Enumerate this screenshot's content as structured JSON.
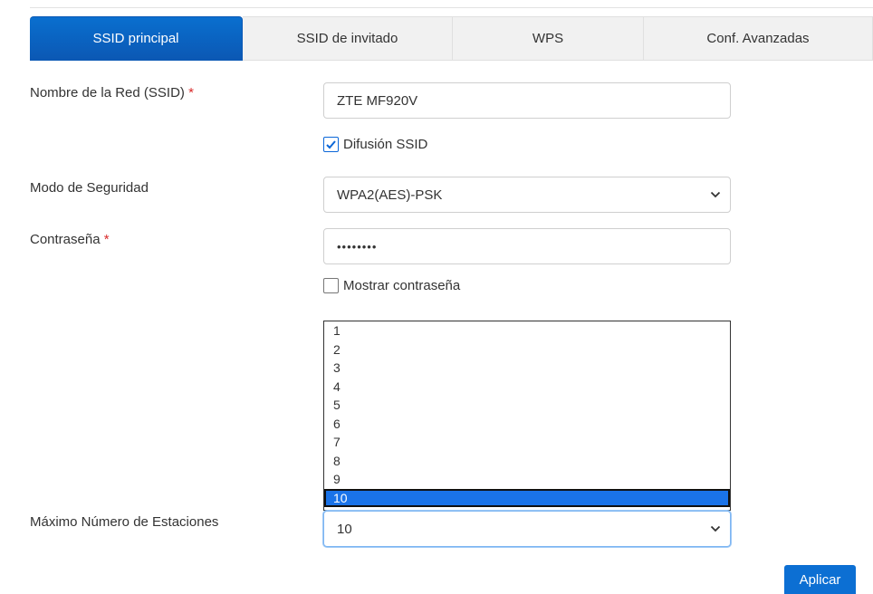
{
  "tabs": [
    {
      "label": "SSID principal",
      "active": true
    },
    {
      "label": "SSID de invitado",
      "active": false
    },
    {
      "label": "WPS",
      "active": false
    },
    {
      "label": "Conf. Avanzadas",
      "active": false
    }
  ],
  "form": {
    "ssid": {
      "label": "Nombre de la Red (SSID)",
      "required_mark": "*",
      "value": "ZTE MF920V"
    },
    "broadcast": {
      "label": "Difusión SSID",
      "checked": true
    },
    "security": {
      "label": "Modo de Seguridad",
      "value": "WPA2(AES)-PSK"
    },
    "password": {
      "label": "Contraseña",
      "required_mark": "*",
      "value": "••••••••"
    },
    "show_password": {
      "label": "Mostrar contraseña",
      "checked": false
    },
    "max_stations": {
      "label": "Máximo Número de Estaciones",
      "value": "10",
      "options": [
        "1",
        "2",
        "3",
        "4",
        "5",
        "6",
        "7",
        "8",
        "9",
        "10"
      ],
      "selected_index": 9
    }
  },
  "apply_label": "Aplicar",
  "colors": {
    "accent": "#0b62c4",
    "required": "#d92b2b",
    "selected_option": "#1a73e8"
  }
}
